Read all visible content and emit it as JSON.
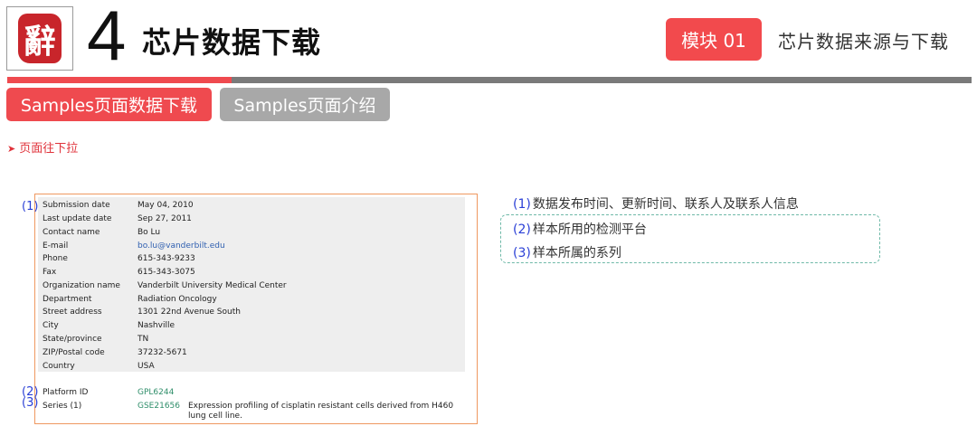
{
  "header": {
    "logo_glyph": "辭",
    "chapter_number": "4",
    "chapter_title": "芯片数据下载",
    "module_badge": "模块 01",
    "module_title": "芯片数据来源与下载"
  },
  "tabs": [
    {
      "label": "Samples页面数据下载",
      "active": true
    },
    {
      "label": "Samples页面介绍",
      "active": false
    }
  ],
  "hint": "页面往下拉",
  "geo": {
    "rows": [
      {
        "key": "Submission date",
        "value": "May 04, 2010"
      },
      {
        "key": "Last update date",
        "value": "Sep 27, 2011"
      },
      {
        "key": "Contact name",
        "value": "Bo Lu"
      },
      {
        "key": "E-mail",
        "value": "bo.lu@vanderbilt.edu"
      },
      {
        "key": "Phone",
        "value": "615-343-9233"
      },
      {
        "key": "Fax",
        "value": "615-343-3075"
      },
      {
        "key": "Organization name",
        "value": "Vanderbilt University Medical Center"
      },
      {
        "key": "Department",
        "value": "Radiation Oncology"
      },
      {
        "key": "Street address",
        "value": "1301 22nd Avenue South"
      },
      {
        "key": "City",
        "value": "Nashville"
      },
      {
        "key": "State/province",
        "value": "TN"
      },
      {
        "key": "ZIP/Postal code",
        "value": "37232-5671"
      },
      {
        "key": "Country",
        "value": "USA"
      }
    ],
    "platform": {
      "key": "Platform ID",
      "value": "GPL6244"
    },
    "series": {
      "key": "Series (1)",
      "value": "GSE21656",
      "description": "Expression profiling of cisplatin resistant cells derived from H460 lung cell line."
    }
  },
  "markers": [
    "(1)",
    "(2)",
    "(3)"
  ],
  "notes": [
    {
      "num": "(1)",
      "text": "数据发布时间、更新时间、联系人及联系人信息"
    },
    {
      "num": "(2)",
      "text": "样本所用的检测平台"
    },
    {
      "num": "(3)",
      "text": "样本所属的系列"
    }
  ],
  "colors": {
    "accent": "#ef4a4f",
    "inactive_tab": "#a8a8a8",
    "marker_blue": "#2a3fd6",
    "link_green": "#2f8e6a"
  }
}
